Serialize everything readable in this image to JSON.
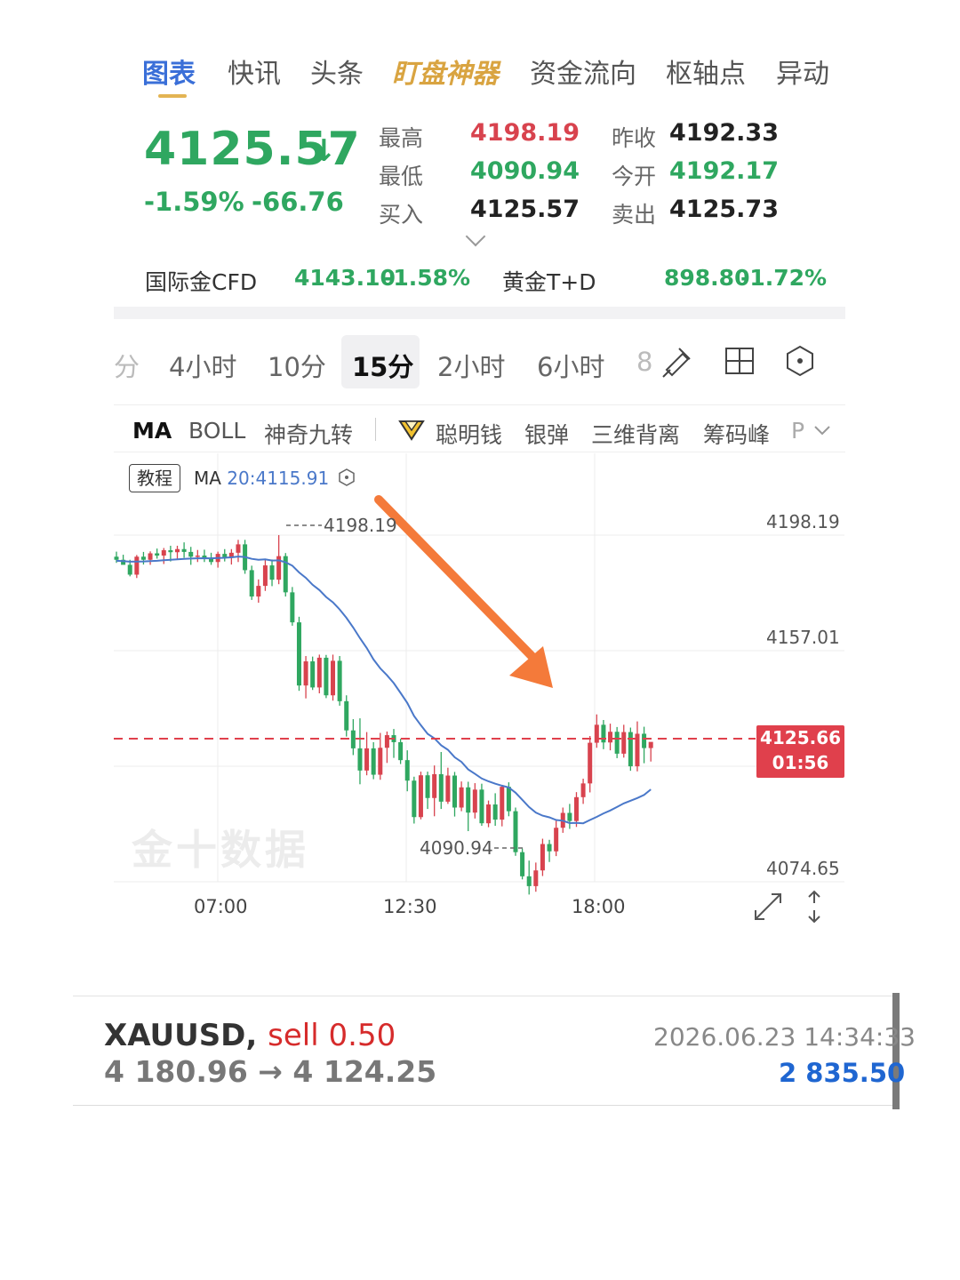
{
  "tabs": [
    {
      "label": "图表",
      "state": "active"
    },
    {
      "label": "快讯",
      "state": "normal"
    },
    {
      "label": "头条",
      "state": "normal"
    },
    {
      "label": "盯盘神器",
      "state": "special"
    },
    {
      "label": "资金流向",
      "state": "normal"
    },
    {
      "label": "枢轴点",
      "state": "normal"
    },
    {
      "label": "异动",
      "state": "normal"
    }
  ],
  "quote": {
    "price": "4125.57",
    "arrow": "↓",
    "change_pct": "-1.59%",
    "change": "-66.76",
    "stats": [
      {
        "label": "最高",
        "value": "4198.19",
        "color": "red"
      },
      {
        "label": "昨收",
        "value": "4192.33",
        "color": "dark"
      },
      {
        "label": "最低",
        "value": "4090.94",
        "color": "green"
      },
      {
        "label": "今开",
        "value": "4192.17",
        "color": "green"
      },
      {
        "label": "买入",
        "value": "4125.57",
        "color": "dark"
      },
      {
        "label": "卖出",
        "value": "4125.73",
        "color": "dark"
      }
    ]
  },
  "related": [
    {
      "name": "国际金CFD",
      "price": "4143.10",
      "pct": "-1.58%"
    },
    {
      "name": "黄金T+D",
      "price": "898.80",
      "pct": "-1.72%"
    }
  ],
  "periods": [
    {
      "label": "分",
      "active": false
    },
    {
      "label": "4小时",
      "active": false
    },
    {
      "label": "10分",
      "active": false
    },
    {
      "label": "15分",
      "active": true
    },
    {
      "label": "2小时",
      "active": false
    },
    {
      "label": "6小时",
      "active": false
    },
    {
      "label": "8",
      "active": false
    }
  ],
  "indicators": [
    "MA",
    "BOLL",
    "神奇九转",
    "聪明钱",
    "银弹",
    "三维背离",
    "筹码峰",
    "P"
  ],
  "chart": {
    "tutorial_label": "教程",
    "ma_label": "MA",
    "ma_value": "20:4115.91",
    "high_label": "4198.19",
    "low_label": "4090.94",
    "current_price": "4125.66",
    "countdown": "01:56",
    "watermark": "金十数据",
    "y_ticks": [
      "4198.19",
      "4157.01",
      "4074.65"
    ],
    "x_ticks": [
      "07:00",
      "12:30",
      "18:00"
    ],
    "colors": {
      "up": "#d8434e",
      "down": "#2fa760",
      "ma": "#4a78c9",
      "arrow": "#f47a3a"
    }
  },
  "chart_data": {
    "type": "candlestick",
    "symbol": "XAUUSD",
    "interval": "15分",
    "ylim": [
      4074.65,
      4198.19
    ],
    "high": 4198.19,
    "low": 4090.94,
    "last": 4125.66,
    "x_ticks": [
      "07:00",
      "12:30",
      "18:00"
    ],
    "candles": [
      [
        4190.5,
        4192.3,
        4188.3,
        4189.4
      ],
      [
        4189.4,
        4191.2,
        4187.7,
        4187.6
      ],
      [
        4187.6,
        4189.4,
        4183.5,
        4184.1
      ],
      [
        4184.1,
        4191.1,
        4182.9,
        4190.5
      ],
      [
        4190.5,
        4192.2,
        4187.7,
        4189.4
      ],
      [
        4189.4,
        4192.4,
        4187.6,
        4191.7
      ],
      [
        4191.7,
        4193.4,
        4189.8,
        4190.9
      ],
      [
        4190.9,
        4193.6,
        4187.9,
        4192.8
      ],
      [
        4192.8,
        4194.4,
        4188.8,
        4192.1
      ],
      [
        4192.1,
        4194.4,
        4189.5,
        4193.2
      ],
      [
        4193.2,
        4195.6,
        4190.1,
        4192.2
      ],
      [
        4192.2,
        4194.0,
        4187.6,
        4190.5
      ],
      [
        4190.5,
        4192.9,
        4188.6,
        4190.9
      ],
      [
        4190.9,
        4193.0,
        4188.6,
        4189.8
      ],
      [
        4189.8,
        4191.9,
        4187.6,
        4188.6
      ],
      [
        4188.6,
        4192.3,
        4186.6,
        4191.5
      ],
      [
        4191.5,
        4193.2,
        4188.8,
        4190.3
      ],
      [
        4190.3,
        4193.2,
        4187.7,
        4191.9
      ],
      [
        4191.9,
        4196.5,
        4188.6,
        4194.9
      ],
      [
        4194.9,
        4196.5,
        4184.4,
        4185.7
      ],
      [
        4185.7,
        4187.3,
        4175.1,
        4176.3
      ],
      [
        4176.3,
        4182.4,
        4174.1,
        4180.1
      ],
      [
        4180.1,
        4189.3,
        4178.3,
        4187.4
      ],
      [
        4187.4,
        4189.5,
        4180.0,
        4182.3
      ],
      [
        4182.3,
        4198.2,
        4180.7,
        4190.7
      ],
      [
        4190.7,
        4191.8,
        4176.3,
        4177.8
      ],
      [
        4177.8,
        4179.7,
        4165.9,
        4167.1
      ],
      [
        4167.1,
        4169.1,
        4142.7,
        4144.6
      ],
      [
        4144.6,
        4155.1,
        4140.0,
        4153.2
      ],
      [
        4153.2,
        4154.9,
        4143.0,
        4143.9
      ],
      [
        4143.9,
        4155.6,
        4141.8,
        4154.5
      ],
      [
        4154.5,
        4155.5,
        4140.1,
        4141.1
      ],
      [
        4141.1,
        4155.6,
        4139.2,
        4153.4
      ],
      [
        4153.4,
        4155.1,
        4137.4,
        4139.0
      ],
      [
        4139.0,
        4141.1,
        4126.4,
        4128.6
      ],
      [
        4128.6,
        4132.6,
        4119.8,
        4122.2
      ],
      [
        4122.2,
        4132.9,
        4109.4,
        4114.3
      ],
      [
        4114.3,
        4128.0,
        4112.6,
        4122.2
      ],
      [
        4122.2,
        4124.4,
        4111.2,
        4112.8
      ],
      [
        4112.8,
        4127.7,
        4111.0,
        4122.4
      ],
      [
        4122.4,
        4128.2,
        4117.0,
        4126.9
      ],
      [
        4126.9,
        4129.1,
        4118.8,
        4124.4
      ],
      [
        4124.4,
        4125.6,
        4116.6,
        4118.0
      ],
      [
        4118.0,
        4121.5,
        4106.9,
        4110.7
      ],
      [
        4110.7,
        4112.1,
        4095.4,
        4097.7
      ],
      [
        4097.7,
        4113.9,
        4096.9,
        4112.6
      ],
      [
        4112.6,
        4113.9,
        4100.6,
        4104.5
      ],
      [
        4104.5,
        4116.1,
        4098.0,
        4113.0
      ],
      [
        4113.0,
        4120.9,
        4100.6,
        4103.2
      ],
      [
        4103.2,
        4115.3,
        4102.4,
        4112.5
      ],
      [
        4112.5,
        4113.8,
        4097.9,
        4101.1
      ],
      [
        4101.1,
        4110.4,
        4099.8,
        4108.3
      ],
      [
        4108.3,
        4110.3,
        4092.7,
        4099.3
      ],
      [
        4099.3,
        4109.8,
        4097.2,
        4107.5
      ],
      [
        4107.5,
        4109.6,
        4094.6,
        4095.5
      ],
      [
        4095.5,
        4103.6,
        4094.1,
        4102.2
      ],
      [
        4102.2,
        4106.2,
        4094.6,
        4096.8
      ],
      [
        4096.8,
        4108.9,
        4094.4,
        4108.5
      ],
      [
        4108.5,
        4110.1,
        4098.0,
        4099.8
      ],
      [
        4099.8,
        4101.1,
        4083.9,
        4085.2
      ],
      [
        4085.2,
        4086.5,
        4075.5,
        4076.6
      ],
      [
        4076.6,
        4082.2,
        4070.1,
        4073.1
      ],
      [
        4073.1,
        4081.5,
        4071.1,
        4078.7
      ],
      [
        4078.7,
        4090.0,
        4076.7,
        4088.1
      ],
      [
        4088.1,
        4089.6,
        4081.7,
        4085.5
      ],
      [
        4085.5,
        4096.4,
        4083.8,
        4093.9
      ],
      [
        4093.9,
        4101.1,
        4092.1,
        4099.2
      ],
      [
        4099.2,
        4102.4,
        4093.5,
        4096.3
      ],
      [
        4096.3,
        4106.6,
        4094.2,
        4104.8
      ],
      [
        4104.8,
        4111.4,
        4102.4,
        4109.7
      ],
      [
        4109.7,
        4126.6,
        4106.5,
        4124.2
      ],
      [
        4124.2,
        4134.3,
        4122.4,
        4130.6
      ],
      [
        4130.6,
        4132.3,
        4121.9,
        4124.3
      ],
      [
        4124.3,
        4131.0,
        4121.5,
        4128.1
      ],
      [
        4128.1,
        4129.8,
        4118.7,
        4120.3
      ],
      [
        4120.3,
        4130.6,
        4118.9,
        4128.0
      ],
      [
        4128.0,
        4129.6,
        4114.2,
        4115.8
      ],
      [
        4115.8,
        4131.8,
        4114.0,
        4127.4
      ],
      [
        4127.4,
        4129.9,
        4116.9,
        4122.3
      ],
      [
        4122.3,
        4124.2,
        4117.5,
        4124.5
      ]
    ]
  },
  "trade": {
    "symbol": "XAUUSD,",
    "side": "sell 0.50",
    "prices": "4 180.96 → 4 124.25",
    "datetime": "2026.06.23 14:34:33",
    "profit": "2 835.50"
  }
}
